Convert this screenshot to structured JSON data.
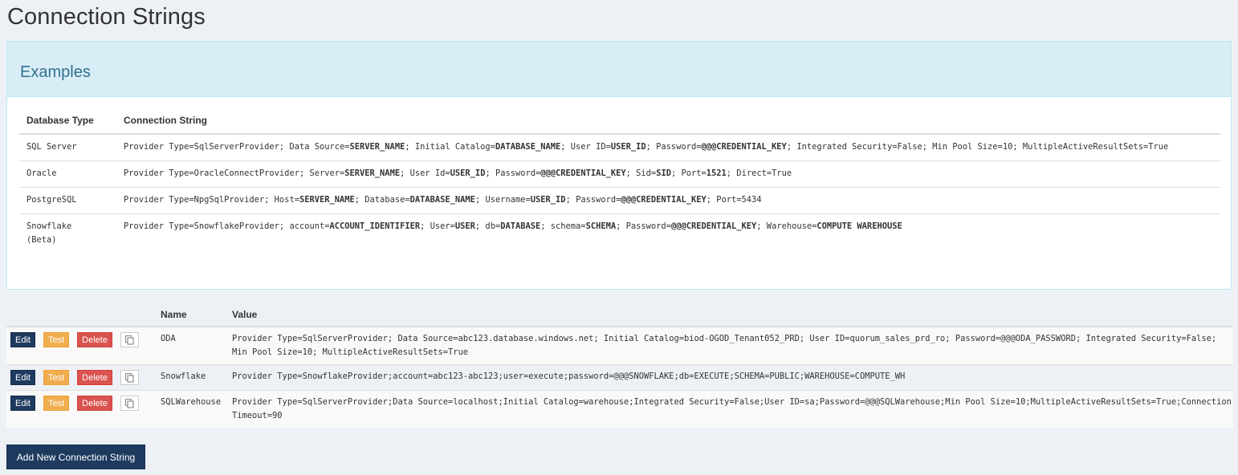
{
  "page": {
    "title": "Connection Strings"
  },
  "examples": {
    "heading": "Examples",
    "columns": [
      "Database Type",
      "Connection String"
    ],
    "rows": [
      {
        "type_line1": "SQL Server",
        "type_line2": "",
        "parts": [
          [
            "Provider Type=SqlServerProvider; Data Source=",
            false
          ],
          [
            "SERVER_NAME",
            true
          ],
          [
            "; Initial Catalog=",
            false
          ],
          [
            "DATABASE_NAME",
            true
          ],
          [
            "; User ID=",
            false
          ],
          [
            "USER_ID",
            true
          ],
          [
            "; Password=",
            false
          ],
          [
            "@@@CREDENTIAL_KEY",
            true
          ],
          [
            "; Integrated Security=False; Min Pool Size=10; MultipleActiveResultSets=True",
            false
          ]
        ]
      },
      {
        "type_line1": "Oracle",
        "type_line2": "",
        "parts": [
          [
            "Provider Type=OracleConnectProvider; Server=",
            false
          ],
          [
            "SERVER_NAME",
            true
          ],
          [
            "; User Id=",
            false
          ],
          [
            "USER_ID",
            true
          ],
          [
            "; Password=",
            false
          ],
          [
            "@@@CREDENTIAL_KEY",
            true
          ],
          [
            "; Sid=",
            false
          ],
          [
            "SID",
            true
          ],
          [
            "; Port=",
            false
          ],
          [
            "1521",
            true
          ],
          [
            "; Direct=True",
            false
          ]
        ]
      },
      {
        "type_line1": "PostgreSQL",
        "type_line2": "",
        "parts": [
          [
            "Provider Type=NpgSqlProvider; Host=",
            false
          ],
          [
            "SERVER_NAME",
            true
          ],
          [
            "; Database=",
            false
          ],
          [
            "DATABASE_NAME",
            true
          ],
          [
            "; Username=",
            false
          ],
          [
            "USER_ID",
            true
          ],
          [
            "; Password=",
            false
          ],
          [
            "@@@CREDENTIAL_KEY",
            true
          ],
          [
            "; Port=5434",
            false
          ]
        ]
      },
      {
        "type_line1": "Snowflake",
        "type_line2": "(Beta)",
        "parts": [
          [
            "Provider Type=SnowflakeProvider; account=",
            false
          ],
          [
            "ACCOUNT_IDENTIFIER",
            true
          ],
          [
            "; User=",
            false
          ],
          [
            "USER",
            true
          ],
          [
            "; db=",
            false
          ],
          [
            "DATABASE",
            true
          ],
          [
            "; schema=",
            false
          ],
          [
            "SCHEMA",
            true
          ],
          [
            "; Password=",
            false
          ],
          [
            "@@@CREDENTIAL_KEY",
            true
          ],
          [
            "; Warehouse=",
            false
          ],
          [
            "COMPUTE WAREHOUSE",
            true
          ]
        ]
      }
    ]
  },
  "connections": {
    "columns": {
      "name": "Name",
      "value": "Value"
    },
    "buttons": {
      "edit": "Edit",
      "test": "Test",
      "delete": "Delete",
      "copy_icon": "copy-icon"
    },
    "rows": [
      {
        "name": "ODA",
        "value": "Provider Type=SqlServerProvider; Data Source=abc123.database.windows.net; Initial Catalog=biod-OGOD_Tenant052_PRD; User ID=quorum_sales_prd_ro; Password=@@@ODA_PASSWORD; Integrated Security=False; Min Pool Size=10; MultipleActiveResultSets=True"
      },
      {
        "name": "Snowflake",
        "value": "Provider Type=SnowflakeProvider;account=abc123-abc123;user=execute;password=@@@SNOWFLAKE;db=EXECUTE;SCHEMA=PUBLIC;WAREHOUSE=COMPUTE_WH"
      },
      {
        "name": "SQLWarehouse",
        "value": "Provider Type=SqlServerProvider;Data Source=localhost;Initial Catalog=warehouse;Integrated Security=False;User ID=sa;Password=@@@SQLWarehouse;Min Pool Size=10;MultipleActiveResultSets=True;Connection Timeout=90"
      }
    ]
  },
  "add_button": {
    "label": "Add New Connection String"
  },
  "colors": {
    "page_bg": "#edf1f6",
    "primary": "#1e3a5f",
    "warning": "#f0ad4e",
    "danger": "#d9534f",
    "info_bg": "#d9edf7",
    "info_text": "#31708f"
  }
}
